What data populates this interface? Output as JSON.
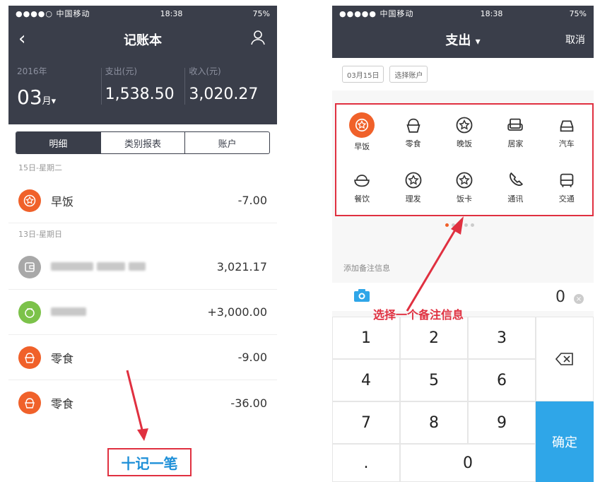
{
  "left": {
    "status": {
      "carrier": "●●●●○ 中国移动",
      "time": "18:38",
      "battery": "75%"
    },
    "nav_title": "记账本",
    "summary": {
      "year_label": "2016年",
      "month": "03",
      "month_unit": "月",
      "expense_label": "支出(元)",
      "expense_value": "1,538.50",
      "income_label": "收入(元)",
      "income_value": "3,020.27"
    },
    "segments": [
      "明细",
      "类别报表",
      "账户"
    ],
    "day1": "15日-星期二",
    "day2": "13日-星期日",
    "rows": [
      {
        "name": "早饭",
        "amount": "-7.00"
      },
      {
        "name": "",
        "amount": "3,021.17"
      },
      {
        "name": "",
        "amount": "+3,000.00"
      },
      {
        "name": "零食",
        "amount": "-9.00"
      },
      {
        "name": "零食",
        "amount": "-36.00"
      }
    ],
    "add_button": "十记一笔"
  },
  "right": {
    "status": {
      "carrier": "●●●●● 中国移动",
      "time": "18:38",
      "battery": "75%"
    },
    "nav_title": "支出",
    "cancel": "取消",
    "date_chip": "03月15日",
    "account_chip": "选择账户",
    "categories": [
      "早饭",
      "零食",
      "晚饭",
      "居家",
      "汽车",
      "餐饮",
      "理发",
      "饭卡",
      "通讯",
      "交通"
    ],
    "memo_placeholder": "添加备注信息",
    "amount": "0",
    "keys": [
      "1",
      "2",
      "3",
      "4",
      "5",
      "6",
      "7",
      "8",
      "9",
      ".",
      "0"
    ],
    "confirm": "确定",
    "annotation": "选择一个备注信息"
  },
  "colors": {
    "dark": "#3a3e4a",
    "accent_orange": "#f0612a",
    "annotation_red": "#e03040",
    "confirm_blue": "#2fa6e8",
    "green": "#7cc24a"
  }
}
